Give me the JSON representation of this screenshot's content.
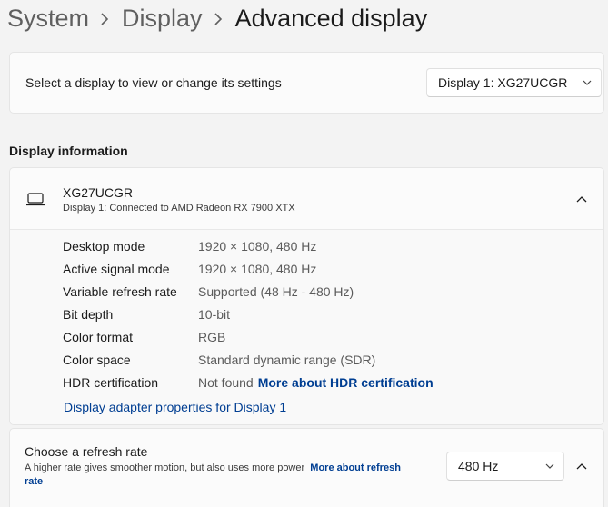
{
  "breadcrumb": {
    "items": [
      "System",
      "Display"
    ],
    "current": "Advanced display"
  },
  "display_select": {
    "label": "Select a display to view or change its settings",
    "selected": "Display 1: XG27UCGR"
  },
  "display_information": {
    "section_title": "Display information",
    "monitor_name": "XG27UCGR",
    "connection": "Display 1: Connected to AMD Radeon RX 7900 XTX",
    "rows": [
      {
        "key": "Desktop mode",
        "value": "1920 × 1080, 480 Hz"
      },
      {
        "key": "Active signal mode",
        "value": "1920 × 1080, 480 Hz"
      },
      {
        "key": "Variable refresh rate",
        "value": "Supported (48 Hz - 480 Hz)"
      },
      {
        "key": "Bit depth",
        "value": "10-bit"
      },
      {
        "key": "Color format",
        "value": "RGB"
      },
      {
        "key": "Color space",
        "value": "Standard dynamic range (SDR)"
      },
      {
        "key": "HDR certification",
        "value": "Not found",
        "link": "More about HDR certification"
      }
    ],
    "adapter_link": "Display adapter properties for Display 1"
  },
  "refresh_rate": {
    "title": "Choose a refresh rate",
    "description": "A higher rate gives smoother motion, but also uses more power",
    "link": "More about refresh rate",
    "selected": "480 Hz"
  },
  "icons": {
    "breadcrumb_separator": "chevron-right-icon",
    "dropdown": "chevron-down-icon",
    "collapse": "chevron-up-icon",
    "monitor": "laptop-icon"
  },
  "colors": {
    "link": "#003e92",
    "background": "#f3f3f3",
    "card": "#fbfbfb"
  }
}
